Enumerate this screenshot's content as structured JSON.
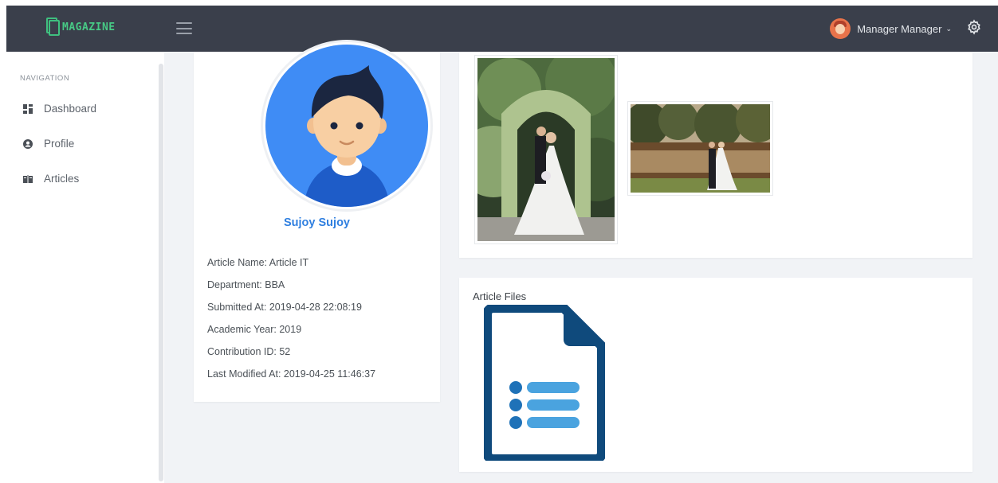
{
  "app": {
    "logo_text": "MAGAZINE",
    "brand_color": "#47c985",
    "topbar_color": "#3a3f4b"
  },
  "header": {
    "user_name": "Manager Manager",
    "user_menu_icon": "chevron-down-icon",
    "settings_icon": "gear-icon"
  },
  "sidebar": {
    "heading": "NAVIGATION",
    "items": [
      {
        "label": "Dashboard",
        "icon": "dashboard-icon"
      },
      {
        "label": "Profile",
        "icon": "user-circle-icon"
      },
      {
        "label": "Articles",
        "icon": "book-icon"
      }
    ]
  },
  "profile": {
    "name": "Sujoy Sujoy",
    "name_color": "#2f7fe0",
    "details": [
      "Article Name: Article IT",
      "Department: BBA",
      "Submitted At: 2019-04-28 22:08:19",
      "Academic Year: 2019",
      "Contribution ID: 52",
      "Last Modified At: 2019-04-25 11:46:37"
    ]
  },
  "files": {
    "title": "Article Files",
    "file_icon": "document-list-icon"
  }
}
